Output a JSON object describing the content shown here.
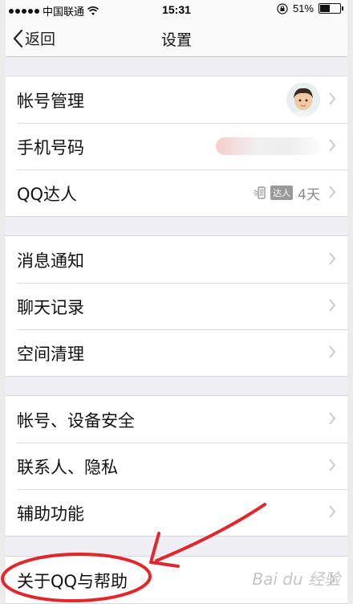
{
  "statusbar": {
    "carrier": "中国联通",
    "time": "15:31",
    "battery_percent": "51%",
    "battery_level": 0.51,
    "signal_icon": "signal-dots-icon",
    "wifi_icon": "wifi-icon",
    "lock_icon": "rotation-lock-icon"
  },
  "navbar": {
    "back_label": "返回",
    "title": "设置"
  },
  "groups": [
    {
      "rows": [
        {
          "label": "帐号管理",
          "accessory": "avatar"
        },
        {
          "label": "手机号码",
          "accessory": "blurred-phone"
        },
        {
          "label": "QQ达人",
          "accessory": "daren",
          "badge_text": "达人",
          "days": "4天"
        }
      ]
    },
    {
      "rows": [
        {
          "label": "消息通知"
        },
        {
          "label": "聊天记录"
        },
        {
          "label": "空间清理"
        }
      ]
    },
    {
      "rows": [
        {
          "label": "帐号、设备安全"
        },
        {
          "label": "联系人、隐私"
        },
        {
          "label": "辅助功能"
        }
      ]
    },
    {
      "rows": [
        {
          "label": "关于QQ与帮助"
        }
      ]
    }
  ],
  "colors": {
    "background": "#efeff4",
    "annotation_red": "#e3262b",
    "chevron": "#c7c7cc"
  },
  "watermark": "Bai du 经验"
}
